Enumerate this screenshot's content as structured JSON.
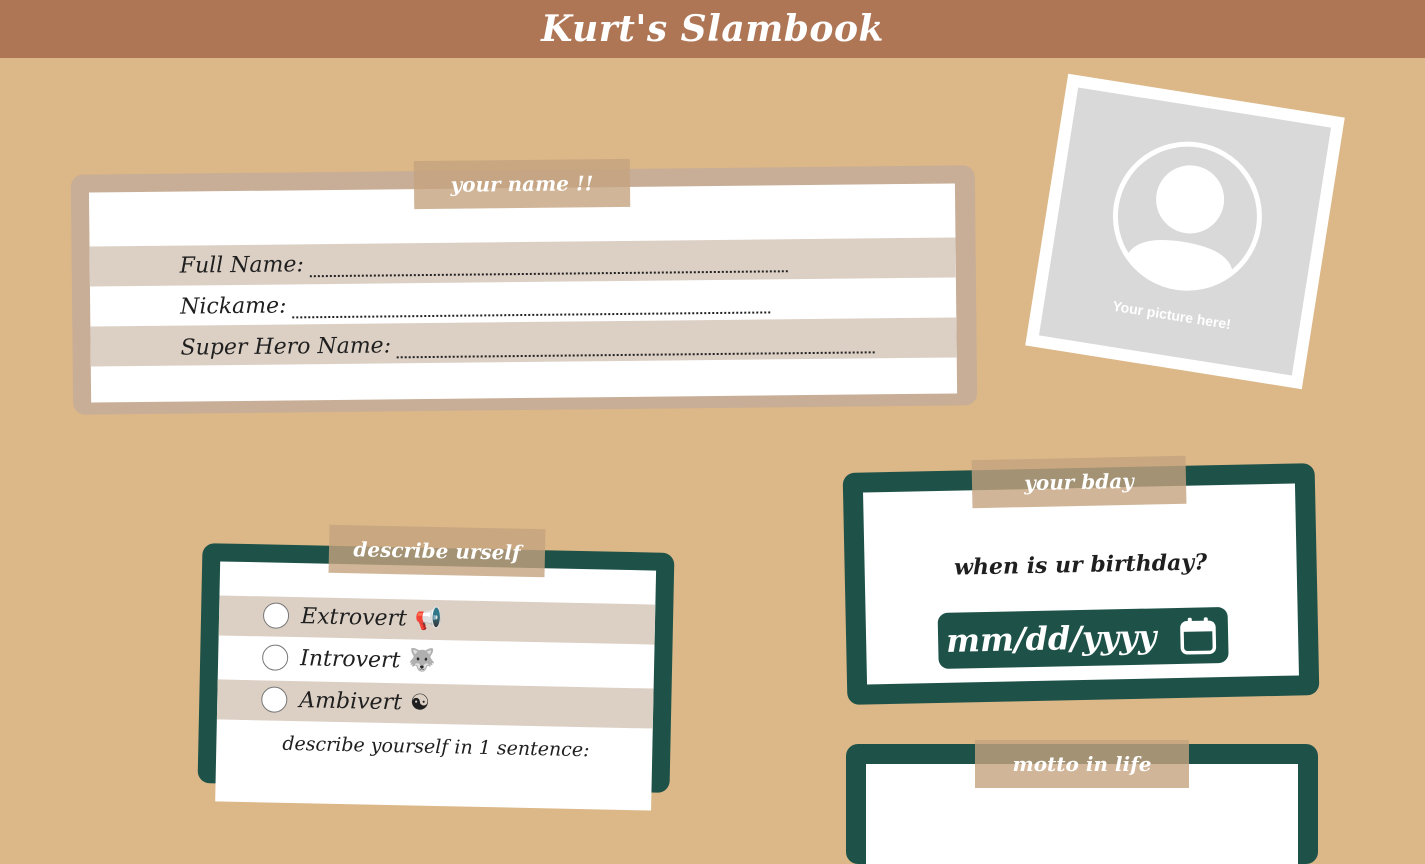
{
  "header": {
    "title": "Kurt's Slambook"
  },
  "name_section": {
    "tape": "your name !!",
    "fields": [
      {
        "label": "Full Name:",
        "value": ""
      },
      {
        "label": "Nickame:",
        "value": ""
      },
      {
        "label": "Super Hero Name:",
        "value": ""
      }
    ]
  },
  "photo": {
    "caption": "Your picture here!",
    "icon": "user-avatar-icon"
  },
  "describe_section": {
    "tape": "describe urself",
    "options": [
      {
        "label": "Extrovert",
        "emoji": "📢",
        "selected": false
      },
      {
        "label": "Introvert",
        "emoji": "🐺",
        "selected": false
      },
      {
        "label": "Ambivert",
        "emoji": "☯",
        "selected": false
      }
    ],
    "sentence_prompt": "describe yourself in 1 sentence:"
  },
  "bday_section": {
    "tape": "your bday",
    "question": "when is ur birthday?",
    "date_placeholder": "mm/dd/yyyy",
    "icon": "calendar-icon"
  },
  "motto_section": {
    "tape": "motto in life"
  },
  "colors": {
    "background": "#dcb787",
    "header": "#af7656",
    "card_green": "#1e5249",
    "card_tan": "#c8ae97",
    "stripe": "#dcd0c5"
  }
}
